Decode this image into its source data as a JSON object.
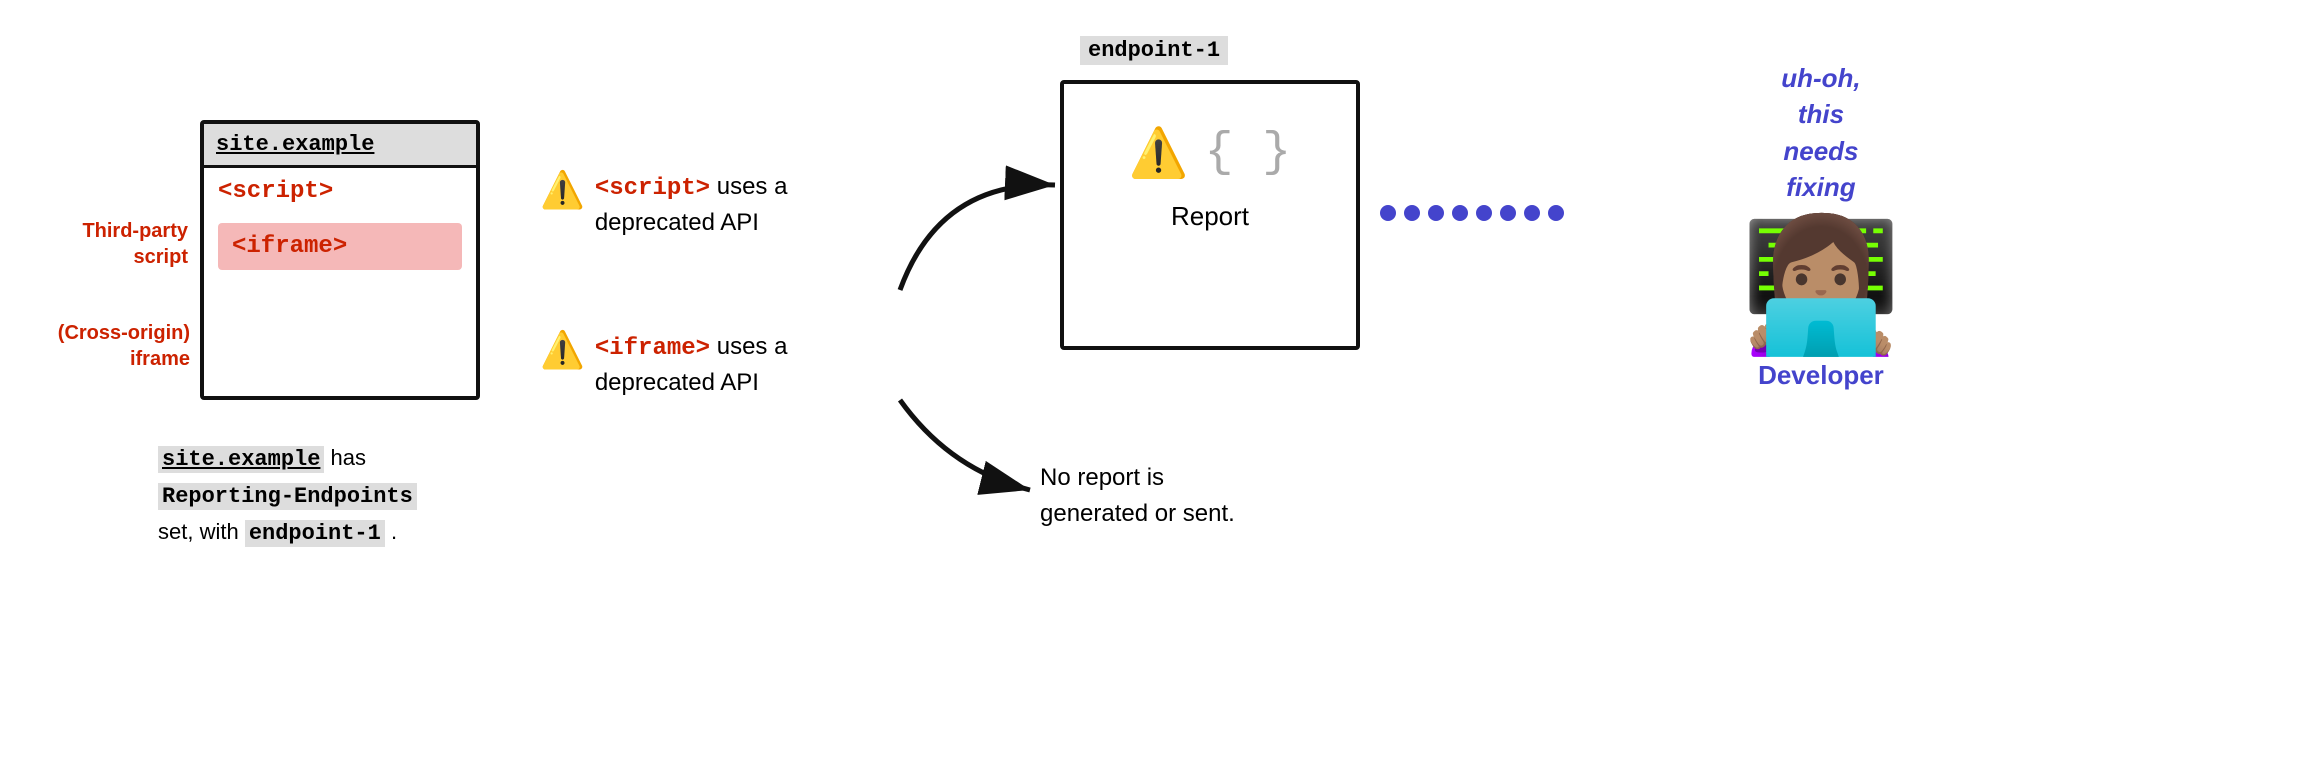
{
  "site_box": {
    "title": "site.example",
    "script_tag": "<script>",
    "iframe_tag": "<iframe>"
  },
  "labels": {
    "third_party": "Third-party\nscript",
    "cross_origin": "(Cross-origin)\niframe"
  },
  "caption": {
    "part1": "site.example",
    "part2": " has",
    "part3": "Reporting-Endpoints",
    "part4": "set, with ",
    "part5": "endpoint-1",
    "part6": " ."
  },
  "warnings": {
    "script": {
      "icon": "⚠️",
      "tag": "<script>",
      "text": " uses a\ndeprecated API"
    },
    "iframe": {
      "icon": "⚠️",
      "tag": "<iframe>",
      "text": " uses a\ndeprecated API"
    }
  },
  "endpoint": {
    "label": "endpoint-1",
    "report_label": "Report",
    "warning_icon": "⚠️",
    "braces": "{ }"
  },
  "no_report": {
    "text": "No report is\ngenerated or sent."
  },
  "developer": {
    "speech": "uh-oh,\nthis\nneeds\nfixing",
    "label": "Developer"
  }
}
